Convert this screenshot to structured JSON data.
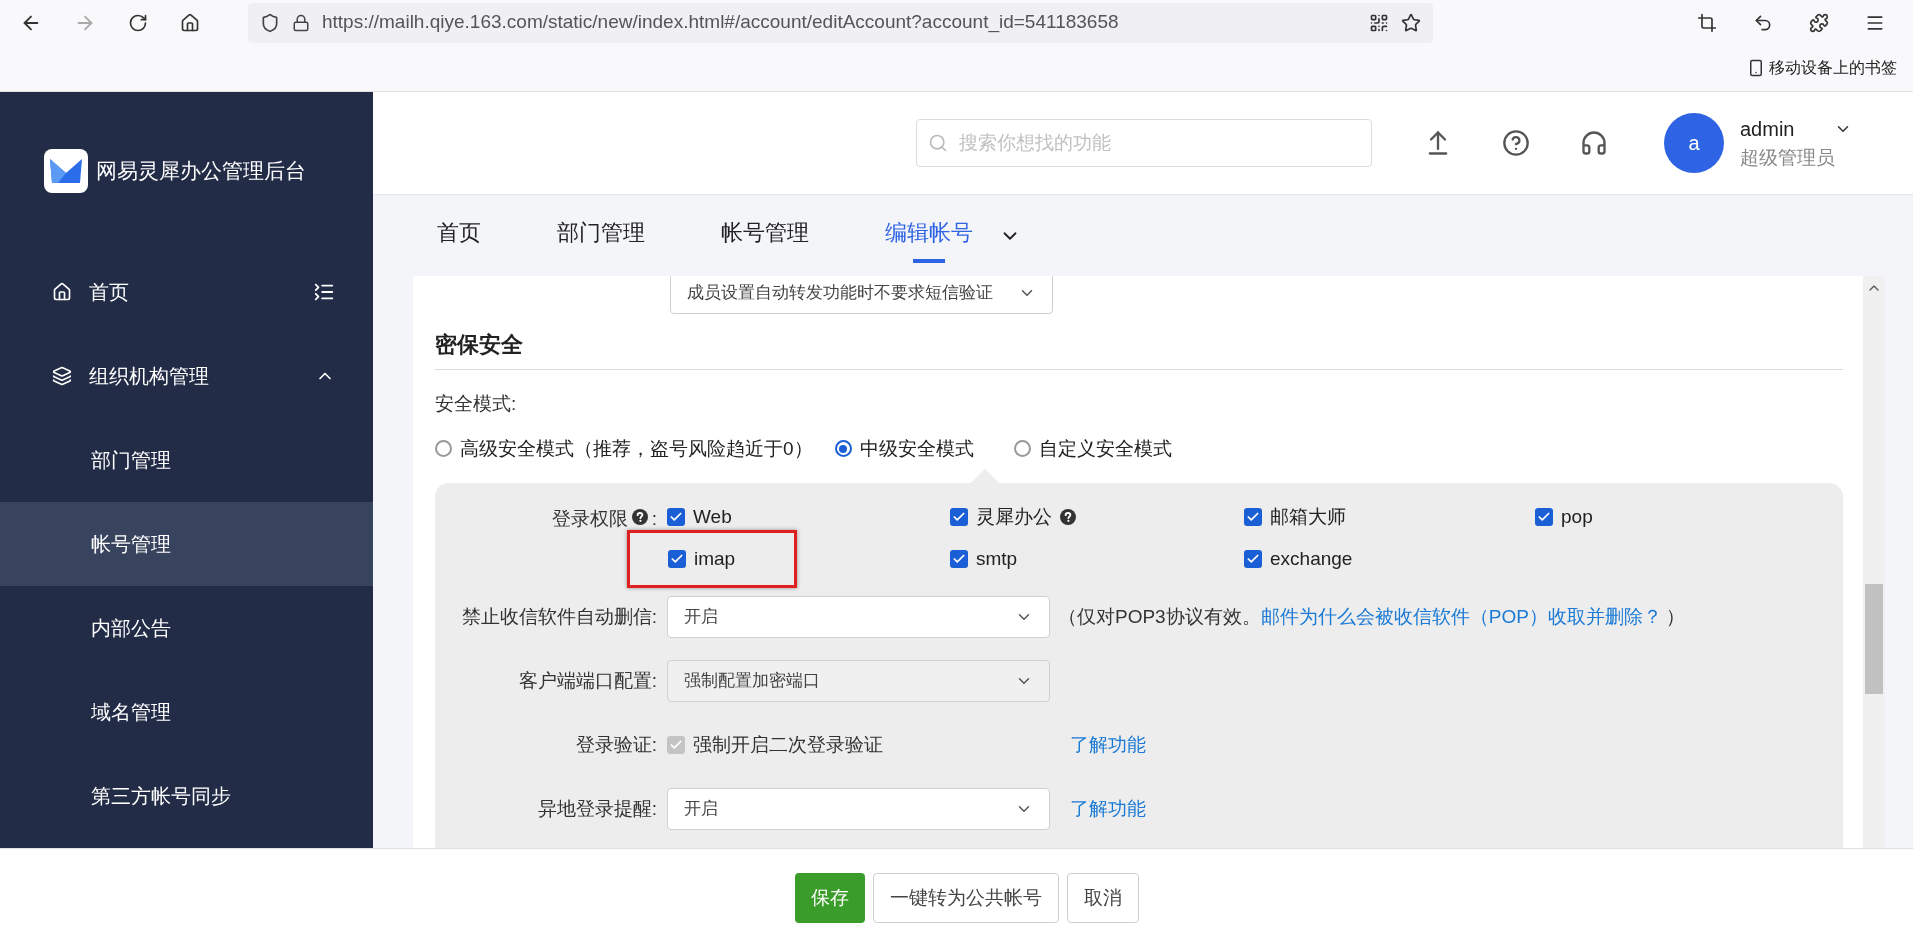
{
  "browser": {
    "url": "https://mailh.qiye.163.com/static/new/index.html#/account/editAccount?account_id=541183658",
    "bookmark": "移动设备上的书签"
  },
  "sidebar": {
    "title": "网易灵犀办公管理后台",
    "items": [
      {
        "label": "首页",
        "kind": "home",
        "selected": false
      },
      {
        "label": "组织机构管理",
        "kind": "group",
        "expanded": true,
        "children": [
          {
            "label": "部门管理",
            "selected": false
          },
          {
            "label": "帐号管理",
            "selected": true
          },
          {
            "label": "内部公告",
            "selected": false
          },
          {
            "label": "域名管理",
            "selected": false
          },
          {
            "label": "第三方帐号同步",
            "selected": false
          }
        ]
      }
    ]
  },
  "header": {
    "search": {
      "placeholder": "搜索你想找的功能"
    },
    "user": {
      "avatar": "a",
      "name": "admin",
      "role": "超级管理员"
    }
  },
  "tabs": [
    {
      "label": "首页",
      "selected": false
    },
    {
      "label": "部门管理",
      "selected": false
    },
    {
      "label": "帐号管理",
      "selected": false
    },
    {
      "label": "编辑帐号",
      "selected": true
    }
  ],
  "top_select": {
    "value": "成员设置自动转发功能时不要求短信验证"
  },
  "section": {
    "title": "密保安全",
    "mode_label": "安全模式:",
    "modes": [
      {
        "label": "高级安全模式（推荐，盗号风险趋近于0）",
        "selected": false
      },
      {
        "label": "中级安全模式",
        "selected": true
      },
      {
        "label": "自定义安全模式",
        "selected": false
      }
    ],
    "permissions": {
      "label": "登录权限",
      "help": true,
      "suffix": ":",
      "items": [
        {
          "label": "Web",
          "checked": true,
          "help": false,
          "highlighted": false
        },
        {
          "label": "灵犀办公",
          "checked": true,
          "help": true,
          "highlighted": false
        },
        {
          "label": "邮箱大师",
          "checked": true,
          "help": false,
          "highlighted": false
        },
        {
          "label": "pop",
          "checked": true,
          "help": false,
          "highlighted": false
        },
        {
          "label": "imap",
          "checked": true,
          "help": false,
          "highlighted": true
        },
        {
          "label": "smtp",
          "checked": true,
          "help": false,
          "highlighted": false
        },
        {
          "label": "exchange",
          "checked": true,
          "help": false,
          "highlighted": false
        }
      ]
    },
    "rows": [
      {
        "kind": "select",
        "label": "禁止收信软件自动删信:",
        "value": "开启",
        "disabled": false,
        "note": "（仅对POP3协议有效。",
        "link": "邮件为什么会被收信软件（POP）收取并删除？",
        "note_end": "）"
      },
      {
        "kind": "select",
        "label": "客户端端口配置:",
        "value": "强制配置加密端口",
        "disabled": true
      },
      {
        "kind": "checkbox",
        "label": "登录验证:",
        "value": "强制开启二次登录验证",
        "checked": true,
        "disabled": true,
        "link": "了解功能"
      },
      {
        "kind": "select",
        "label": "异地登录提醒:",
        "value": "开启",
        "disabled": false,
        "link": "了解功能"
      }
    ]
  },
  "footer": {
    "buttons": [
      {
        "label": "保存",
        "kind": "primary"
      },
      {
        "label": "一键转为公共帐号",
        "kind": "default"
      },
      {
        "label": "取消",
        "kind": "default"
      }
    ]
  }
}
